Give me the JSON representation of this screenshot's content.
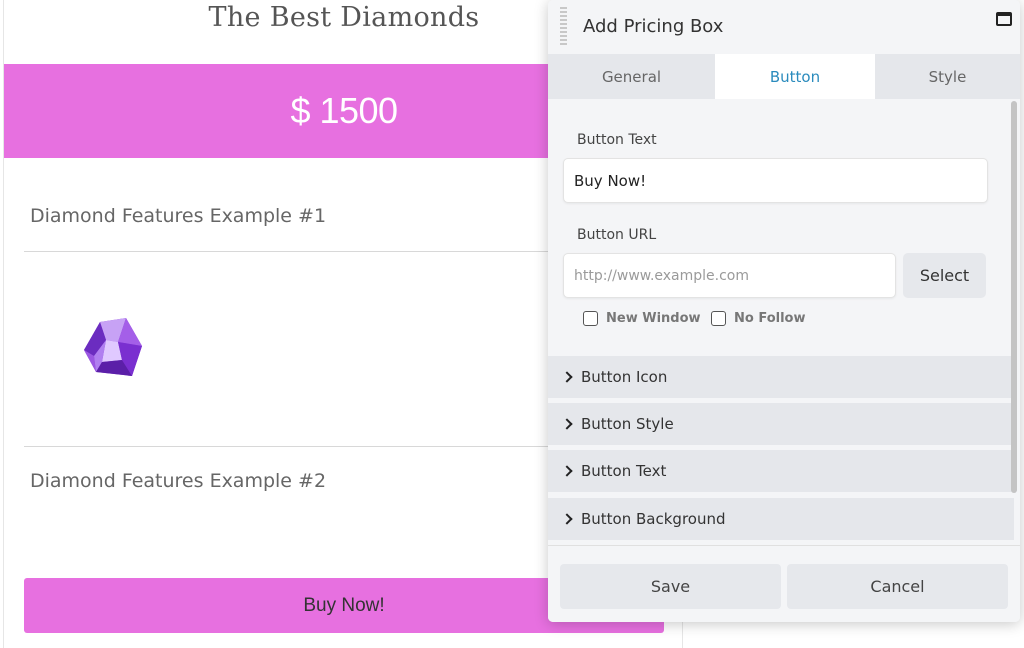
{
  "pricing": {
    "title": "The Best Diamonds",
    "price": "$ 1500",
    "features": [
      "Diamond Features Example #1",
      "Diamond Features Example #2"
    ],
    "button_label": "Buy Now!",
    "accent_color": "#e770e0"
  },
  "modal": {
    "title": "Add Pricing Box",
    "tabs": [
      {
        "label": "General",
        "active": false
      },
      {
        "label": "Button",
        "active": true
      },
      {
        "label": "Style",
        "active": false
      }
    ],
    "button_text": {
      "label": "Button Text",
      "value": "Buy Now!"
    },
    "button_url": {
      "label": "Button URL",
      "placeholder": "http://www.example.com",
      "value": ""
    },
    "select_label": "Select",
    "checkboxes": [
      {
        "label": "New Window",
        "checked": false
      },
      {
        "label": "No Follow",
        "checked": false
      }
    ],
    "sections": [
      "Button Icon",
      "Button Style",
      "Button Text",
      "Button Background"
    ],
    "footer": {
      "save_label": "Save",
      "cancel_label": "Cancel"
    },
    "active_tab_color": "#2a8bbd"
  }
}
